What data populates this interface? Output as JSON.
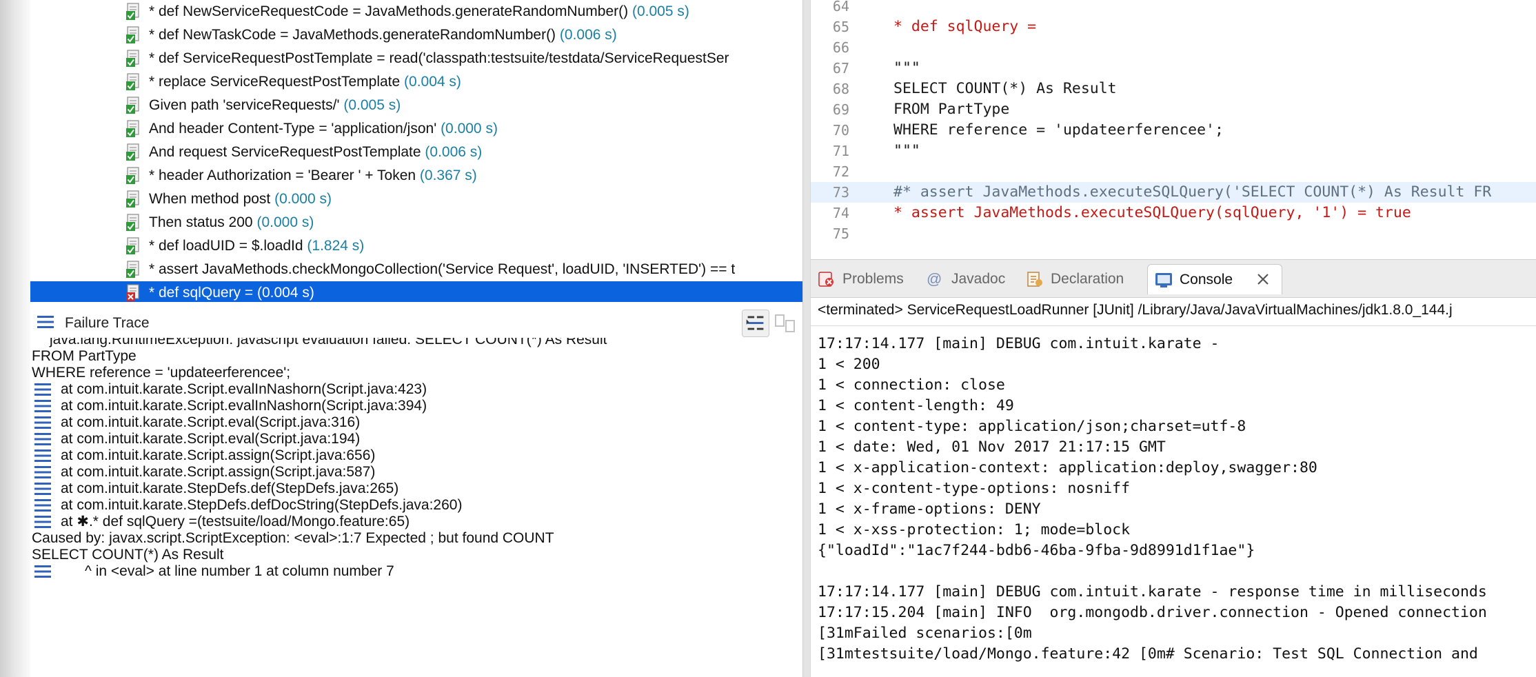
{
  "test_tree": {
    "rows": [
      {
        "label": "* def NewServiceRequestCode = JavaMethods.generateRandomNumber()",
        "time": "(0.005 s)",
        "status": "passed"
      },
      {
        "label": "* def NewTaskCode = JavaMethods.generateRandomNumber()",
        "time": "(0.006 s)",
        "status": "passed"
      },
      {
        "label": "* def ServiceRequestPostTemplate = read('classpath:testsuite/testdata/ServiceRequestSer",
        "time": "",
        "status": "passed"
      },
      {
        "label": "* replace ServiceRequestPostTemplate",
        "time": "(0.004 s)",
        "status": "passed"
      },
      {
        "label": "Given path 'serviceRequests/'",
        "time": "(0.005 s)",
        "status": "passed"
      },
      {
        "label": "And header Content-Type = 'application/json'",
        "time": "(0.000 s)",
        "status": "passed"
      },
      {
        "label": "And request ServiceRequestPostTemplate",
        "time": "(0.006 s)",
        "status": "passed"
      },
      {
        "label": "* header Authorization = 'Bearer ' + Token",
        "time": "(0.367 s)",
        "status": "passed"
      },
      {
        "label": "When method post",
        "time": "(0.000 s)",
        "status": "passed"
      },
      {
        "label": "Then status 200",
        "time": "(0.000 s)",
        "status": "passed"
      },
      {
        "label": "* def loadUID = $.loadId",
        "time": "(1.824 s)",
        "status": "passed"
      },
      {
        "label": "* assert JavaMethods.checkMongoCollection('Service Request', loadUID, 'INSERTED') == t",
        "time": "",
        "status": "passed"
      },
      {
        "label": "* def sqlQuery = (0.004 s)",
        "time": "",
        "status": "failed"
      }
    ]
  },
  "failure_trace": {
    "title": "Failure Trace",
    "lines": [
      {
        "kind": "clip",
        "text": "java.lang.RuntimeException: javascript evaluation failed: SELECT COUNT(*) As Result"
      },
      {
        "kind": "plain",
        "text": "FROM PartType"
      },
      {
        "kind": "plain",
        "text": "WHERE reference = 'updateerferencee';"
      },
      {
        "kind": "stack",
        "text": "at com.intuit.karate.Script.evalInNashorn(Script.java:423)"
      },
      {
        "kind": "stack",
        "text": "at com.intuit.karate.Script.evalInNashorn(Script.java:394)"
      },
      {
        "kind": "stack",
        "text": "at com.intuit.karate.Script.eval(Script.java:316)"
      },
      {
        "kind": "stack",
        "text": "at com.intuit.karate.Script.eval(Script.java:194)"
      },
      {
        "kind": "stack",
        "text": "at com.intuit.karate.Script.assign(Script.java:656)"
      },
      {
        "kind": "stack",
        "text": "at com.intuit.karate.Script.assign(Script.java:587)"
      },
      {
        "kind": "stack",
        "text": "at com.intuit.karate.StepDefs.def(StepDefs.java:265)"
      },
      {
        "kind": "stack",
        "text": "at com.intuit.karate.StepDefs.defDocString(StepDefs.java:260)"
      },
      {
        "kind": "stack",
        "text": "at ✱.* def sqlQuery =(testsuite/load/Mongo.feature:65)"
      },
      {
        "kind": "plain",
        "text": "Caused by: javax.script.ScriptException: <eval>:1:7 Expected ; but found COUNT"
      },
      {
        "kind": "plain",
        "text": "SELECT COUNT(*) As Result"
      },
      {
        "kind": "stack",
        "text": "      ^ in <eval> at line number 1 at column number 7"
      }
    ]
  },
  "editor": {
    "lines": [
      {
        "num": "64",
        "text": "",
        "style": "normal",
        "highlight": false
      },
      {
        "num": "65",
        "text": "* def sqlQuery =",
        "style": "red",
        "highlight": false
      },
      {
        "num": "66",
        "text": "",
        "style": "normal",
        "highlight": false
      },
      {
        "num": "67",
        "text": "\"\"\"",
        "style": "normal",
        "highlight": false
      },
      {
        "num": "68",
        "text": "SELECT COUNT(*) As Result",
        "style": "normal",
        "highlight": false
      },
      {
        "num": "69",
        "text": "FROM PartType",
        "style": "normal",
        "highlight": false
      },
      {
        "num": "70",
        "text": "WHERE reference = 'updateerferencee';",
        "style": "normal",
        "highlight": false
      },
      {
        "num": "71",
        "text": "\"\"\"",
        "style": "normal",
        "highlight": false
      },
      {
        "num": "72",
        "text": "",
        "style": "normal",
        "highlight": false
      },
      {
        "num": "73",
        "text": "#* assert JavaMethods.executeSQLQuery('SELECT COUNT(*) As Result FR",
        "style": "comment",
        "highlight": true
      },
      {
        "num": "74",
        "text": "* assert JavaMethods.executeSQLQuery(sqlQuery, '1') = true",
        "style": "red",
        "highlight": false
      },
      {
        "num": "75",
        "text": "",
        "style": "normal",
        "highlight": false
      }
    ]
  },
  "view_tabs": {
    "problems": "Problems",
    "javadoc": "Javadoc",
    "declaration": "Declaration",
    "console": "Console"
  },
  "console": {
    "status": "<terminated> ServiceRequestLoadRunner [JUnit] /Library/Java/JavaVirtualMachines/jdk1.8.0_144.j",
    "lines": [
      "17:17:14.177 [main] DEBUG com.intuit.karate -",
      "1 < 200",
      "1 < connection: close",
      "1 < content-length: 49",
      "1 < content-type: application/json;charset=utf-8",
      "1 < date: Wed, 01 Nov 2017 21:17:15 GMT",
      "1 < x-application-context: application:deploy,swagger:80",
      "1 < x-content-type-options: nosniff",
      "1 < x-frame-options: DENY",
      "1 < x-xss-protection: 1; mode=block",
      "{\"loadId\":\"1ac7f244-bdb6-46ba-9fba-9d8991d1f1ae\"}",
      "",
      "17:17:14.177 [main] DEBUG com.intuit.karate - response time in milliseconds",
      "17:17:15.204 [main] INFO  org.mongodb.driver.connection - Opened connection",
      "[31mFailed scenarios:[0m",
      "[31mtestsuite/load/Mongo.feature:42 [0m# Scenario: Test SQL Connection and"
    ]
  },
  "colors": {
    "selection": "#0b63de",
    "time_text": "#1a7fa3",
    "keyword_red": "#c41a16",
    "comment": "#5f7081",
    "pass_green": "#2e9b3a",
    "fail_red": "#d12a2a"
  }
}
